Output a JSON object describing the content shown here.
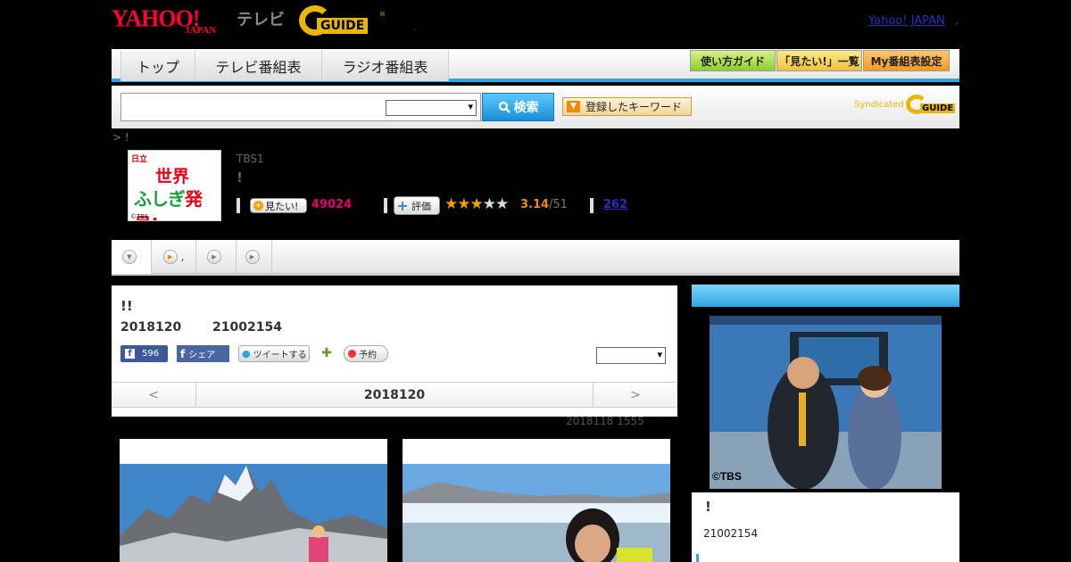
{
  "header": {
    "yahoo_logo": "YAHOO!",
    "yahoo_logo_sub": "JAPAN",
    "tv_label": "テレビ",
    "gguide_logo": "GUIDE",
    "yahoo_japan_link": "Yahoo! JAPAN",
    "link_sep": ",",
    "dot": ","
  },
  "nav": {
    "tabs": [
      {
        "label": "トップ"
      },
      {
        "label": "テレビ番組表"
      },
      {
        "label": "ラジオ番組表"
      }
    ],
    "buttons": [
      {
        "label": "使い方ガイド"
      },
      {
        "label": "「見たい!」一覧"
      },
      {
        "label": "My番組表設定"
      }
    ]
  },
  "search": {
    "input_value": "",
    "select_value": "",
    "button_label": "検索",
    "keyword_label": "登録したキーワード",
    "syndicated_text": "Syndicated",
    "syndicated_logo": "GUIDE"
  },
  "program": {
    "breadcrumb": "> !",
    "station": "TBS1",
    "title": "!",
    "thumb": {
      "brand": "日立",
      "line1": "世界",
      "line2a": "ふしぎ",
      "line2b": "発見!",
      "copyright": "©TBS"
    },
    "want_label": "見たい!",
    "want_count": "49024",
    "eval_label": "評価",
    "rating": "3.14",
    "rating_total": "/51",
    "stars_filled": 3,
    "stars_total": 5,
    "review_count": "262"
  },
  "subtabs": [
    {
      "label": ""
    },
    {
      "label": ","
    },
    {
      "label": ""
    },
    {
      "label": ""
    }
  ],
  "episode": {
    "title": "!!",
    "date": "2018120",
    "time": "21002154",
    "like_count": "596",
    "share_label": "シェア",
    "tweet_label": "ツイートする",
    "reserve_label": "予約",
    "select_value": "",
    "prev_label": "<",
    "current_label": "2018120",
    "next_label": ">",
    "updated": "2018118  1555"
  },
  "side": {
    "image_caption": "©TBS",
    "title": "!",
    "time": "21002154"
  },
  "colors": {
    "accent_blue": "#2aa7e0",
    "want_pink": "#e4006e",
    "rating_orange": "#f08a00",
    "yahoo_red": "#ff0033",
    "gguide_yellow": "#e9b700"
  }
}
